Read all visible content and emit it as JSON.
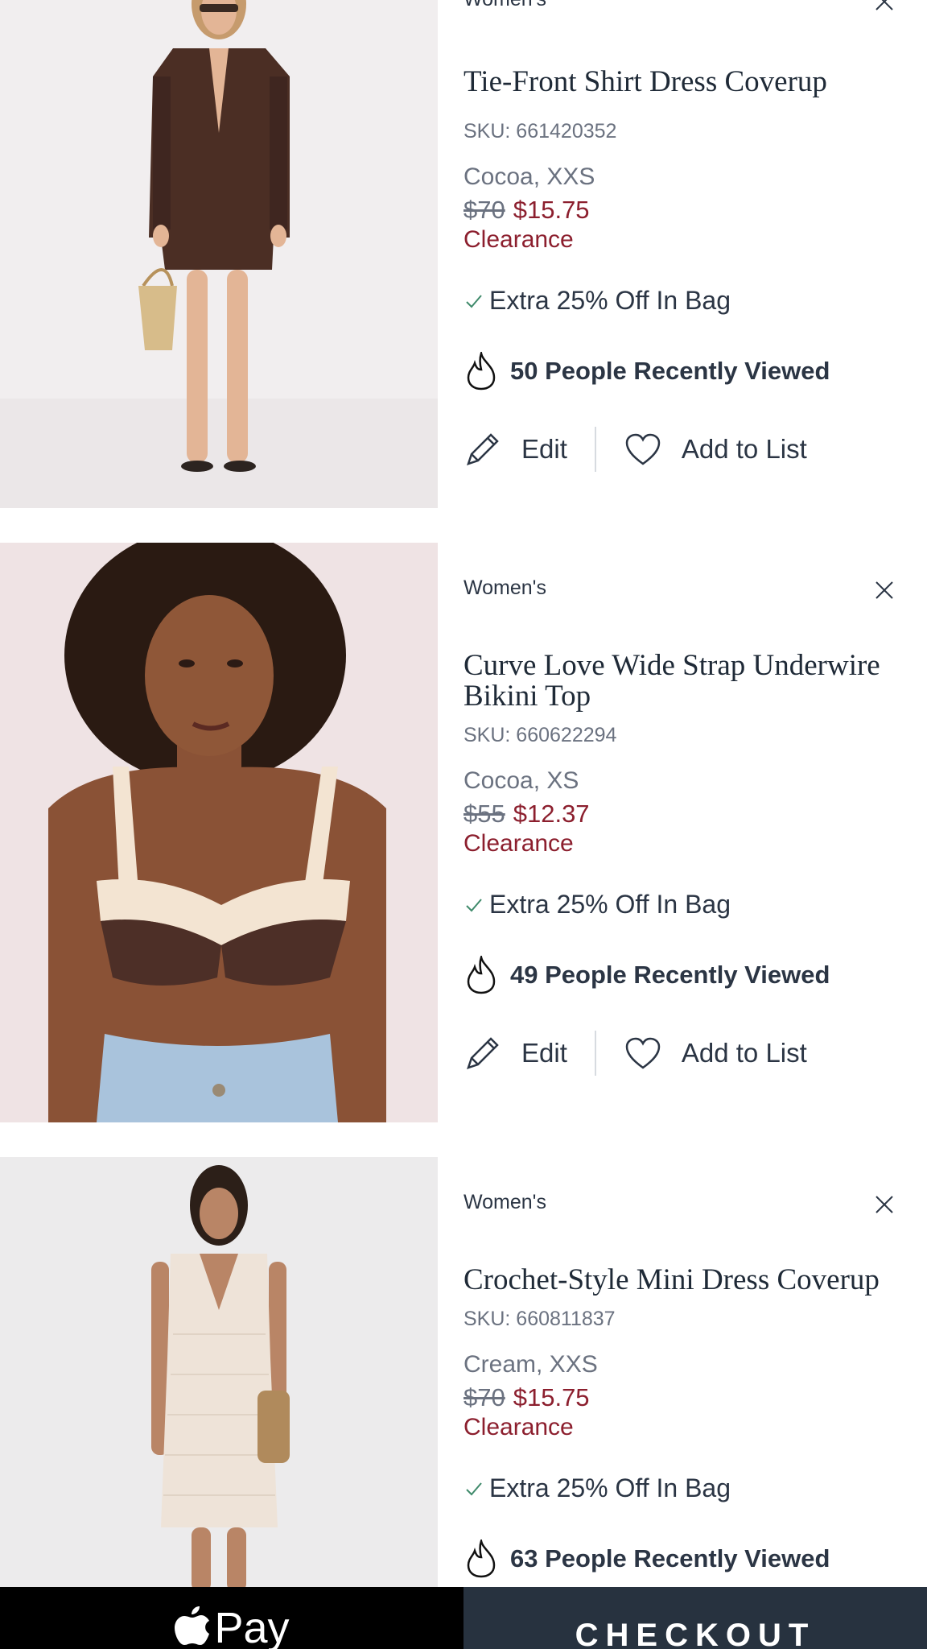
{
  "items": [
    {
      "category": "Women's",
      "title": "Tie-Front Shirt Dress Coverup",
      "sku": "SKU: 661420352",
      "variant": "Cocoa, XXS",
      "price_old": "$70",
      "price_new": "$15.75",
      "badge": "Clearance",
      "promo": "Extra 25% Off In Bag",
      "viewed": "50 People Recently Viewed",
      "edit_label": "Edit",
      "list_label": "Add to List",
      "image": "woman-brown-shirt-dress-photo"
    },
    {
      "category": "Women's",
      "title": "Curve Love Wide Strap Underwire Bikini Top",
      "sku": "SKU: 660622294",
      "variant": "Cocoa, XS",
      "price_old": "$55",
      "price_new": "$12.37",
      "badge": "Clearance",
      "promo": "Extra 25% Off In Bag",
      "viewed": "49 People Recently Viewed",
      "edit_label": "Edit",
      "list_label": "Add to List",
      "image": "woman-brown-bikini-top-photo"
    },
    {
      "category": "Women's",
      "title": "Crochet-Style Mini Dress Coverup",
      "sku": "SKU: 660811837",
      "variant": "Cream, XXS",
      "price_old": "$70",
      "price_new": "$15.75",
      "badge": "Clearance",
      "promo": "Extra 25% Off In Bag",
      "viewed": "63 People Recently Viewed",
      "image": "woman-cream-crochet-dress-photo"
    }
  ],
  "footer": {
    "apple_pay_label": " Pay",
    "checkout_label": "CHECKOUT"
  },
  "colors": {
    "text": "#1f2a37",
    "muted": "#6b7280",
    "sale": "#8c1f2e",
    "checkout_bg": "#27323f",
    "promo_check": "#3f8a6b"
  }
}
